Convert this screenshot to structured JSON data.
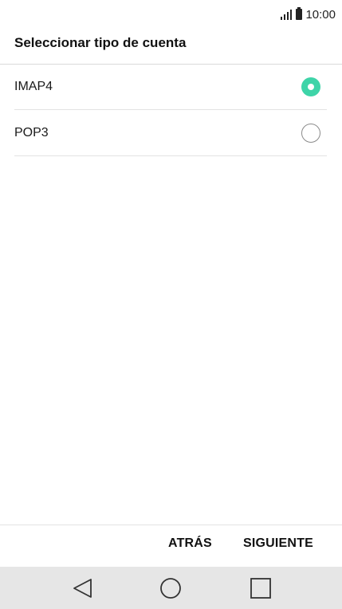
{
  "status_bar": {
    "time": "10:00",
    "icons": [
      "signal-icon",
      "battery-icon"
    ]
  },
  "header": {
    "title": "Seleccionar tipo de cuenta"
  },
  "account_types": [
    {
      "label": "IMAP4",
      "selected": true
    },
    {
      "label": "POP3",
      "selected": false
    }
  ],
  "actions": {
    "back_label": "ATRÁS",
    "next_label": "SIGUIENTE"
  },
  "nav_bar": {
    "icons": [
      "back-icon",
      "home-icon",
      "recent-apps-icon"
    ]
  },
  "colors": {
    "accent": "#3ed4a8",
    "nav_background": "#e6e6e6"
  }
}
